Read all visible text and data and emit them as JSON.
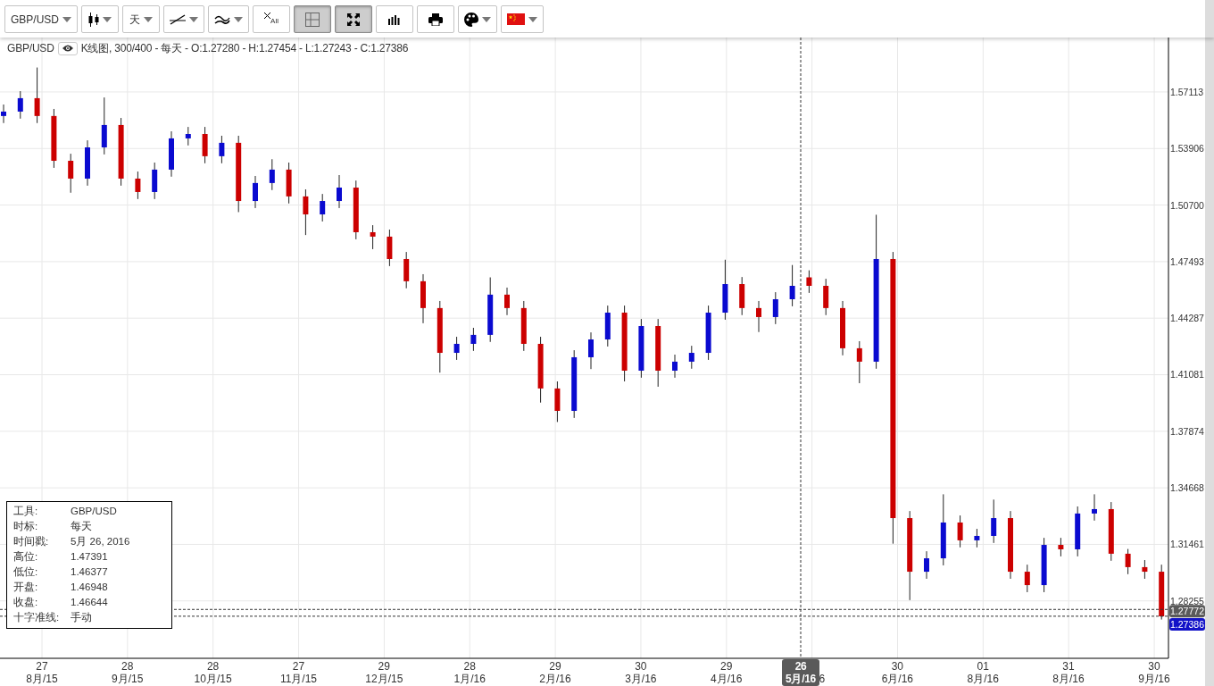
{
  "toolbar": [
    {
      "kind": "text",
      "label": "GBP/USD",
      "dropdown": true,
      "pressed": false
    },
    {
      "kind": "candles",
      "dropdown": true,
      "pressed": false
    },
    {
      "kind": "text",
      "label": "天",
      "dropdown": true,
      "pressed": false
    },
    {
      "kind": "drawline",
      "dropdown": true,
      "pressed": false
    },
    {
      "kind": "indicator",
      "dropdown": true,
      "pressed": false
    },
    {
      "kind": "clearall",
      "label": "All",
      "dropdown": false,
      "pressed": false
    },
    {
      "kind": "grid",
      "dropdown": false,
      "pressed": true
    },
    {
      "kind": "fullscreen",
      "dropdown": false,
      "pressed": true
    },
    {
      "kind": "volume",
      "dropdown": false,
      "pressed": false
    },
    {
      "kind": "print",
      "dropdown": false,
      "pressed": false
    },
    {
      "kind": "palette",
      "dropdown": true,
      "pressed": false
    },
    {
      "kind": "flag",
      "dropdown": true,
      "pressed": false
    }
  ],
  "chart": {
    "symbol": "GBP/USD",
    "visible": true,
    "summary": "K线图, 300/400 - 每天 - O:1.27280 - H:1.27454 - L:1.27243 - C:1.27386",
    "date_axis": [
      {
        "day": "27",
        "month": "8月/15"
      },
      {
        "day": "28",
        "month": "9月/15"
      },
      {
        "day": "28",
        "month": "10月/15"
      },
      {
        "day": "27",
        "month": "11月/15"
      },
      {
        "day": "29",
        "month": "12月/15"
      },
      {
        "day": "28",
        "month": "1月/16"
      },
      {
        "day": "29",
        "month": "2月/16"
      },
      {
        "day": "30",
        "month": "3月/16"
      },
      {
        "day": "29",
        "month": "4月/16"
      },
      {
        "month": "6",
        "kind": "partial"
      },
      {
        "day": "30",
        "month": "6月/16"
      },
      {
        "day": "01",
        "month": "8月/16"
      },
      {
        "day": "31",
        "month": "8月/16"
      },
      {
        "day": "30",
        "month": "9月/16"
      }
    ],
    "crosshair": {
      "date_label": "26\n5月/16",
      "price_label": "1.27772"
    },
    "last_price_label": "1.27386",
    "chart_data": {
      "type": "candlestick",
      "grid": true,
      "ylim": [
        1.25,
        1.602
      ],
      "yticks": [
        {
          "value": 1.57113,
          "label": "1.57113"
        },
        {
          "value": 1.53906,
          "label": "1.53906"
        },
        {
          "value": 1.507,
          "label": "1.50700"
        },
        {
          "value": 1.47493,
          "label": "1.47493"
        },
        {
          "value": 1.44287,
          "label": "1.44287"
        },
        {
          "value": 1.41081,
          "label": "1.41081"
        },
        {
          "value": 1.37874,
          "label": "1.37874"
        },
        {
          "value": 1.34668,
          "label": "1.34668"
        },
        {
          "value": 1.31461,
          "label": "1.31461"
        },
        {
          "value": 1.28255,
          "label": "1.28255"
        }
      ],
      "ohlc": [
        [
          1.5575,
          1.564,
          1.5535,
          1.56
        ],
        [
          1.56,
          1.5716,
          1.556,
          1.5676
        ],
        [
          1.5676,
          1.585,
          1.5535,
          1.5575
        ],
        [
          1.5575,
          1.5615,
          1.5281,
          1.5321
        ],
        [
          1.5321,
          1.5361,
          1.514,
          1.522
        ],
        [
          1.522,
          1.5437,
          1.518,
          1.5397
        ],
        [
          1.5397,
          1.568,
          1.5357,
          1.5524
        ],
        [
          1.5524,
          1.5564,
          1.518,
          1.522
        ],
        [
          1.522,
          1.526,
          1.5104,
          1.5144
        ],
        [
          1.5144,
          1.5311,
          1.5104,
          1.5271
        ],
        [
          1.5271,
          1.5488,
          1.5231,
          1.5448
        ],
        [
          1.5448,
          1.5513,
          1.5408,
          1.5473
        ],
        [
          1.5473,
          1.5513,
          1.5307,
          1.5347
        ],
        [
          1.5347,
          1.5463,
          1.5307,
          1.5423
        ],
        [
          1.5423,
          1.5463,
          1.503,
          1.5093
        ],
        [
          1.5093,
          1.5235,
          1.5053,
          1.5195
        ],
        [
          1.5195,
          1.533,
          1.5155,
          1.5271
        ],
        [
          1.5271,
          1.5311,
          1.5079,
          1.5119
        ],
        [
          1.5119,
          1.5159,
          1.49,
          1.5017
        ],
        [
          1.5017,
          1.5133,
          1.4977,
          1.5093
        ],
        [
          1.5093,
          1.524,
          1.5053,
          1.5169
        ],
        [
          1.5169,
          1.5209,
          1.4876,
          1.4916
        ],
        [
          1.4916,
          1.4956,
          1.482,
          1.4891
        ],
        [
          1.4891,
          1.4931,
          1.4724,
          1.4764
        ],
        [
          1.4764,
          1.4804,
          1.4598,
          1.4638
        ],
        [
          1.4638,
          1.4678,
          1.44,
          1.4486
        ],
        [
          1.4486,
          1.4526,
          1.412,
          1.4232
        ],
        [
          1.4232,
          1.4323,
          1.4192,
          1.4283
        ],
        [
          1.4283,
          1.4374,
          1.4243,
          1.4334
        ],
        [
          1.4334,
          1.466,
          1.4294,
          1.4562
        ],
        [
          1.4562,
          1.4602,
          1.4446,
          1.4486
        ],
        [
          1.4486,
          1.4526,
          1.4243,
          1.4283
        ],
        [
          1.4283,
          1.4323,
          1.395,
          1.403
        ],
        [
          1.403,
          1.407,
          1.384,
          1.3903
        ],
        [
          1.3903,
          1.4247,
          1.3863,
          1.4207
        ],
        [
          1.4207,
          1.4348,
          1.414,
          1.4308
        ],
        [
          1.4308,
          1.45,
          1.4268,
          1.446
        ],
        [
          1.446,
          1.45,
          1.407,
          1.4131
        ],
        [
          1.4131,
          1.4424,
          1.4091,
          1.4384
        ],
        [
          1.4384,
          1.4424,
          1.404,
          1.4131
        ],
        [
          1.4131,
          1.4222,
          1.4091,
          1.4182
        ],
        [
          1.4182,
          1.4272,
          1.4142,
          1.4232
        ],
        [
          1.4232,
          1.45,
          1.4192,
          1.446
        ],
        [
          1.446,
          1.476,
          1.442,
          1.4622
        ],
        [
          1.4622,
          1.4662,
          1.4446,
          1.4486
        ],
        [
          1.4486,
          1.4526,
          1.435,
          1.4435
        ],
        [
          1.4435,
          1.4576,
          1.4395,
          1.4536
        ],
        [
          1.4536,
          1.473,
          1.4496,
          1.4612
        ],
        [
          1.466,
          1.47,
          1.4572,
          1.4612
        ],
        [
          1.4612,
          1.4652,
          1.4446,
          1.4486
        ],
        [
          1.4486,
          1.4526,
          1.4218,
          1.4258
        ],
        [
          1.4258,
          1.4298,
          1.406,
          1.4182
        ],
        [
          1.4182,
          1.5015,
          1.4142,
          1.4764
        ],
        [
          1.4764,
          1.4804,
          1.315,
          1.3295
        ],
        [
          1.3295,
          1.3335,
          1.283,
          1.2991
        ],
        [
          1.2991,
          1.3107,
          1.2951,
          1.3067
        ],
        [
          1.3067,
          1.343,
          1.3027,
          1.327
        ],
        [
          1.327,
          1.331,
          1.3129,
          1.3169
        ],
        [
          1.3169,
          1.3234,
          1.3129,
          1.3194
        ],
        [
          1.3194,
          1.34,
          1.3154,
          1.3295
        ],
        [
          1.3295,
          1.3335,
          1.2951,
          1.2991
        ],
        [
          1.2991,
          1.3031,
          1.2875,
          1.2915
        ],
        [
          1.2915,
          1.3183,
          1.2875,
          1.3143
        ],
        [
          1.3143,
          1.3183,
          1.3078,
          1.3118
        ],
        [
          1.3118,
          1.3361,
          1.3078,
          1.3321
        ],
        [
          1.3321,
          1.343,
          1.3281,
          1.3346
        ],
        [
          1.3346,
          1.3386,
          1.3053,
          1.3093
        ],
        [
          1.3093,
          1.312,
          1.2977,
          1.3017
        ],
        [
          1.3017,
          1.3057,
          1.2951,
          1.2991
        ],
        [
          1.2991,
          1.3031,
          1.272,
          1.2738
        ]
      ]
    }
  },
  "info_box": [
    {
      "label": "工具:",
      "value": "GBP/USD"
    },
    {
      "label": "时标:",
      "value": "每天"
    },
    {
      "label": "时间戳:",
      "value": "5月 26, 2016"
    },
    {
      "label": "高位:",
      "value": "1.47391"
    },
    {
      "label": "低位:",
      "value": "1.46377"
    },
    {
      "label": "开盘:",
      "value": "1.46948"
    },
    {
      "label": "收盘:",
      "value": "1.46644"
    },
    {
      "label": "十字准线:",
      "value": "手动"
    }
  ]
}
